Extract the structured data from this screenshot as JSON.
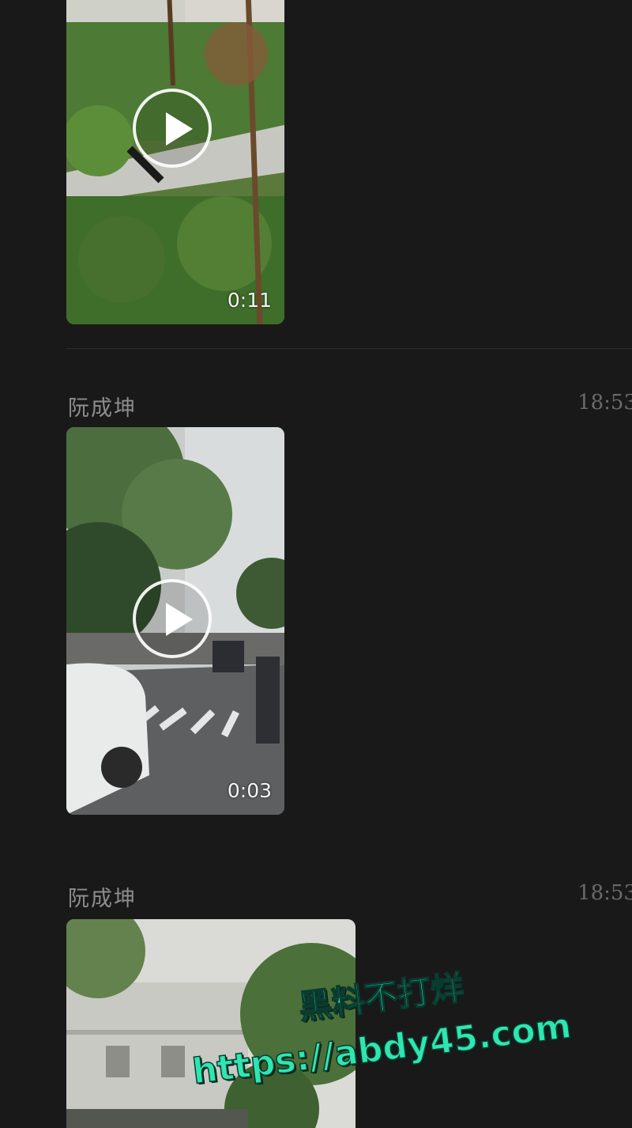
{
  "messages": [
    {
      "sender": "",
      "time": "",
      "video": {
        "duration": "0:11"
      }
    },
    {
      "sender": "阮成坤",
      "time": "18:53",
      "video": {
        "duration": "0:03"
      }
    },
    {
      "sender": "阮成坤",
      "time": "18:53",
      "video": {
        "duration": ""
      }
    }
  ],
  "watermark": {
    "line1": "黑料不打烊",
    "line2": "https://abdy45.com"
  },
  "colors": {
    "background": "#1a191a",
    "sender_text": "#8d8d8d",
    "time_text": "#6a6a6a",
    "watermark": "#2ee6b0"
  },
  "icons": [
    "play-icon"
  ]
}
